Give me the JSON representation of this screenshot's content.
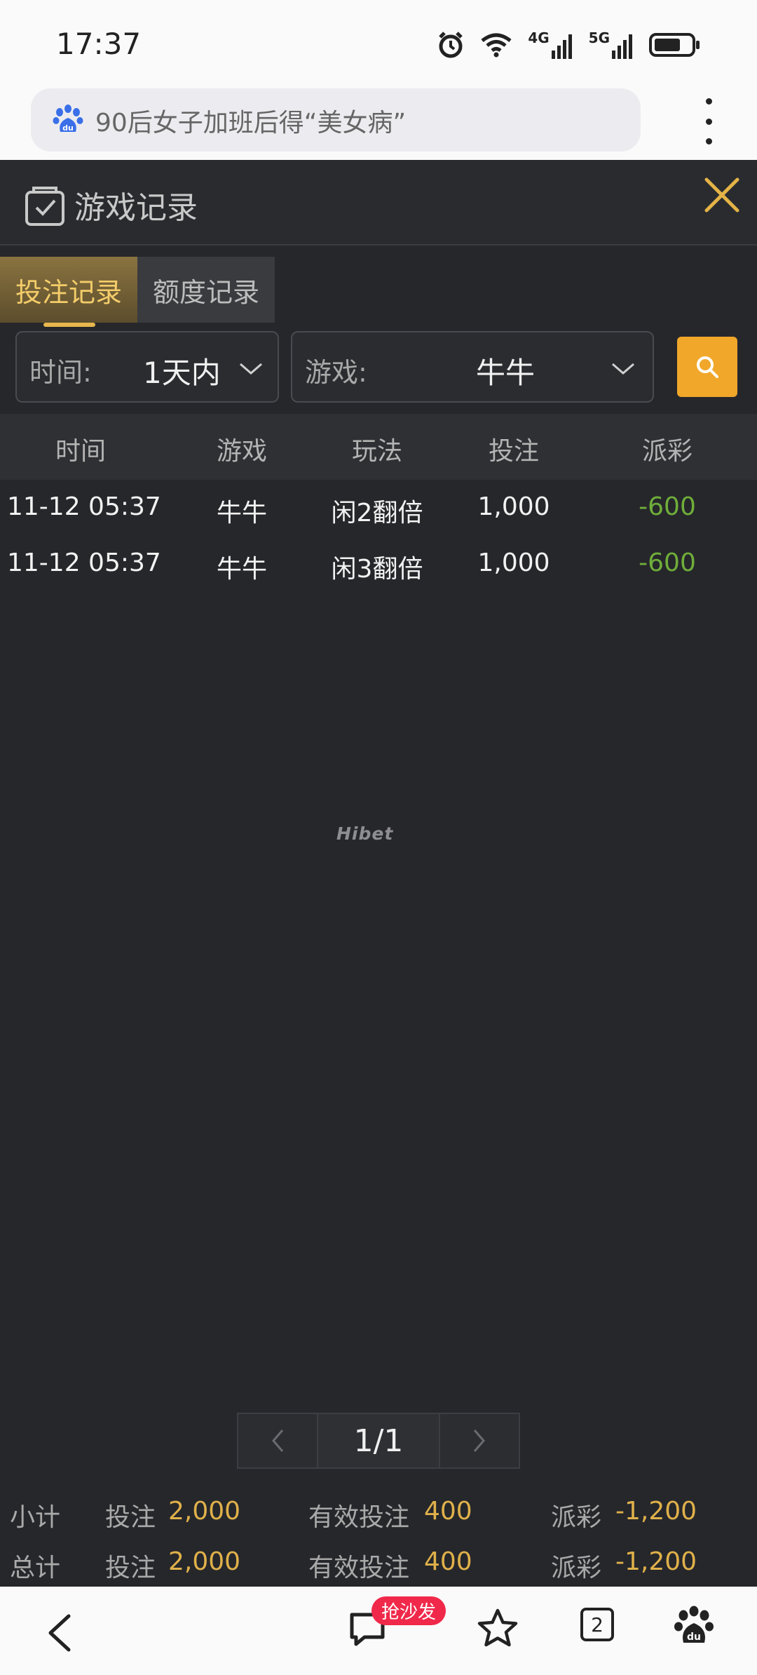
{
  "status_bar": {
    "time": "17:37",
    "network_4g": "4G",
    "network_5g": "5G"
  },
  "browser": {
    "address_text": "90后女子加班后得“美女病”",
    "tab_count": "2",
    "comment_badge": "抢沙发"
  },
  "panel": {
    "title": "游戏记录",
    "tabs": [
      {
        "label": "投注记录",
        "active": true
      },
      {
        "label": "额度记录",
        "active": false
      }
    ],
    "filters": {
      "time_label": "时间:",
      "time_value": "1天内",
      "game_label": "游戏:",
      "game_value": "牛牛"
    },
    "table": {
      "headers": [
        "时间",
        "游戏",
        "玩法",
        "投注",
        "派彩"
      ],
      "rows": [
        {
          "time": "11-12 05:37",
          "game": "牛牛",
          "play": "闲2翻倍",
          "bet": "1,000",
          "payout": "-600"
        },
        {
          "time": "11-12 05:37",
          "game": "牛牛",
          "play": "闲3翻倍",
          "bet": "1,000",
          "payout": "-600"
        }
      ]
    },
    "watermark": "Hibet",
    "pagination": {
      "info": "1/1"
    },
    "summary": {
      "subtotal": {
        "label": "小计",
        "bet_label": "投注",
        "bet": "2,000",
        "valid_label": "有效投注",
        "valid": "400",
        "payout_label": "派彩",
        "payout": "-1,200"
      },
      "total": {
        "label": "总计",
        "bet_label": "投注",
        "bet": "2,000",
        "valid_label": "有效投注",
        "valid": "400",
        "payout_label": "派彩",
        "payout": "-1,200"
      }
    }
  },
  "colors": {
    "accent": "#f0a72a",
    "gold_text": "#e0b14a",
    "loss_green": "#6fae3a",
    "panel_bg": "#26272b"
  }
}
